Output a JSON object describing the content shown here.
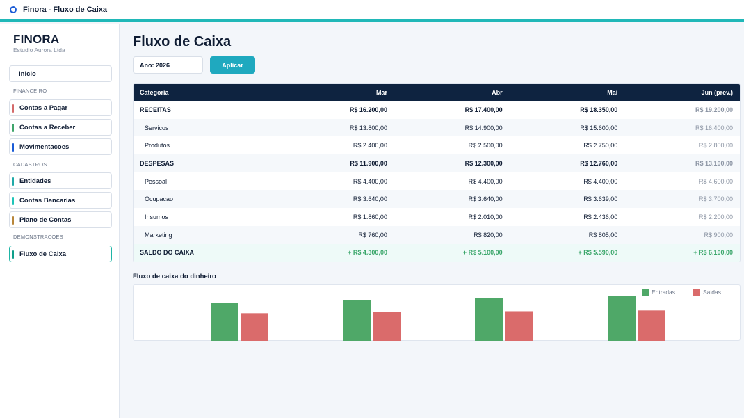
{
  "window": {
    "title": "Finora  -  Fluxo de Caixa"
  },
  "sidebar": {
    "brand": "FINORA",
    "company": "Estudio Aurora Ltda",
    "home": "Inicio",
    "sections": [
      "FINANCEIRO",
      "CADASTROS",
      "DEMONSTRACOES"
    ],
    "items": [
      {
        "label": "Contas a Pagar",
        "color": "#d46a6a"
      },
      {
        "label": "Contas a Receber",
        "color": "#3fa56b"
      },
      {
        "label": "Movimentacoes",
        "color": "#1a5bd6"
      },
      {
        "label": "Entidades",
        "color": "#1fa9a8"
      },
      {
        "label": "Contas Bancarias",
        "color": "#1fc4b8"
      },
      {
        "label": "Plano de Contas",
        "color": "#b8863a"
      },
      {
        "label": "Fluxo de Caixa",
        "color": "#0e9f8a"
      }
    ]
  },
  "main": {
    "title": "Fluxo de Caixa",
    "year_value": "Ano: 2026",
    "apply_label": "Aplicar",
    "table": {
      "headers": [
        "Categoria",
        "Mar",
        "Abr",
        "Mai",
        "Jun (prev.)"
      ],
      "rows": [
        {
          "kind": "group",
          "cells": [
            "RECEITAS",
            "R$ 16.200,00",
            "R$ 17.400,00",
            "R$ 18.350,00",
            "R$ 19.200,00"
          ]
        },
        {
          "kind": "sub",
          "cells": [
            "Servicos",
            "R$ 13.800,00",
            "R$ 14.900,00",
            "R$ 15.600,00",
            "R$ 16.400,00"
          ]
        },
        {
          "kind": "sub",
          "cells": [
            "Produtos",
            "R$ 2.400,00",
            "R$ 2.500,00",
            "R$ 2.750,00",
            "R$ 2.800,00"
          ]
        },
        {
          "kind": "group",
          "cells": [
            "DESPESAS",
            "R$ 11.900,00",
            "R$ 12.300,00",
            "R$ 12.760,00",
            "R$ 13.100,00"
          ]
        },
        {
          "kind": "sub",
          "cells": [
            "Pessoal",
            "R$ 4.400,00",
            "R$ 4.400,00",
            "R$ 4.400,00",
            "R$ 4.600,00"
          ]
        },
        {
          "kind": "sub",
          "cells": [
            "Ocupacao",
            "R$ 3.640,00",
            "R$ 3.640,00",
            "R$ 3.639,00",
            "R$ 3.700,00"
          ]
        },
        {
          "kind": "sub",
          "cells": [
            "Insumos",
            "R$ 1.860,00",
            "R$ 2.010,00",
            "R$ 2.436,00",
            "R$ 2.200,00"
          ]
        },
        {
          "kind": "sub",
          "cells": [
            "Marketing",
            "R$ 760,00",
            "R$ 820,00",
            "R$ 805,00",
            "R$ 900,00"
          ]
        },
        {
          "kind": "total",
          "cells": [
            "SALDO DO CAIXA",
            "+ R$ 4.300,00",
            "+ R$ 5.100,00",
            "+ R$ 5.590,00",
            "+ R$ 6.100,00"
          ]
        }
      ]
    },
    "chart_title": "Fluxo de caixa do dinheiro"
  },
  "chart_data": {
    "type": "bar",
    "categories": [
      "",
      "",
      "",
      ""
    ],
    "series": [
      {
        "name": "Entradas",
        "color": "#4fa868",
        "values": [
          16200,
          17400,
          18350,
          19200
        ]
      },
      {
        "name": "Saidas",
        "color": "#da6b6b",
        "values": [
          11900,
          12300,
          12760,
          13100
        ]
      }
    ],
    "legend_position": "top-right",
    "grid": false
  }
}
